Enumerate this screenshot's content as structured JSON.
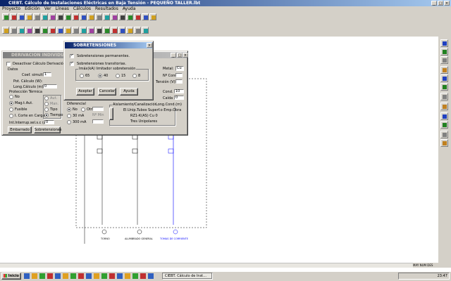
{
  "app": {
    "title": "CIEBT. Cálculo de Instalaciones Eléctricas en Baja Tensión - PEQUEÑO TALLER.lbt",
    "menu": [
      "Proyecto",
      "Edición",
      "Ver",
      "Líneas",
      "Cálculos",
      "Resultados",
      "Ayuda"
    ]
  },
  "derivacion": {
    "title": "DERIVACION INDIVIDUAL",
    "desactivar": "Desactivar Cálculo Derivación Individual",
    "datos": "Datos",
    "coef_simult": "Coef. simult.",
    "coef_simult_value": "1",
    "pot_calculo": "Pot. Cálculo (W):",
    "long_calculo": "Long.Cálculo (m):",
    "long_calculo_value": "0",
    "proteccion": "Protección Térmica",
    "opts": [
      "No",
      "Mag.t.Aut.",
      "Fusible",
      "I. Corte en Carga"
    ],
    "tipo_opts": [
      "Aut.",
      "Man.",
      "Tipo",
      "Tiempo"
    ],
    "bt_label": "Int.Interrup.sel.s.c (A):",
    "bt_value": "0",
    "embarrado": "Embarrado",
    "sobretensiones_btn": "Sobretensiones",
    "diferencial": "Diferencial",
    "dif_opts": [
      "No",
      "Otro",
      "30 mA",
      "300 mA"
    ],
    "dif_side": [
      "I.Dif",
      "Sensib.",
      "Nº Min"
    ],
    "aislamiento": "Aislamiento/Canalización/Polaridad",
    "aisl_lines": [
      "El.Unip.Tubos Superf.o Emp.Obra",
      "RZ1-K(AS) Cu 0",
      "Tres Unipolares"
    ],
    "right_labels": [
      "Metal:",
      "Nº Cond.",
      "Tensión (V)",
      "Cond.",
      "Caída (%)",
      "Long.Cond.(m)"
    ],
    "metal_value": "Cu",
    "cond_value": "10",
    "caida_value": "0"
  },
  "sobretensiones": {
    "title": "SOBRETENSIONES",
    "permanentes": "Sobretensiones permanentes.",
    "transitorias": "Sobretensiones transitorias.",
    "limitador_label": "Imáx(kA) limitador sobretensión",
    "options": [
      "65",
      "40",
      "15",
      "8"
    ],
    "selected": "40",
    "aceptar": "Aceptar",
    "cancelar": "Cancelar",
    "ayuda": "Ayuda"
  },
  "diagram": {
    "labels": [
      "TORNO",
      "ALUMBRADO GENERAL",
      "TOMAS DE CORRIENTE"
    ]
  },
  "taskbar": {
    "start": "Inicio",
    "task": "CIEBT. Cálculo de Inst...",
    "clock": "23:47"
  },
  "status": [
    "MAY",
    "NUM",
    "DES"
  ],
  "colors": {
    "titlebar": "#0a246a",
    "face": "#d4d0c8",
    "blue_line": "#0000ff"
  }
}
